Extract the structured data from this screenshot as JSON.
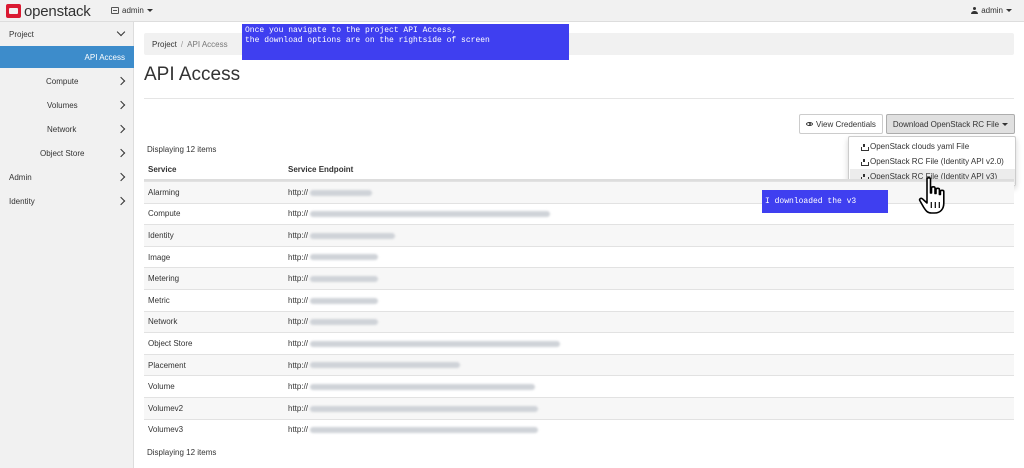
{
  "topbar": {
    "logo_text": "openstack",
    "project": "admin",
    "user": "admin"
  },
  "sidebar": {
    "items": [
      {
        "label": "Project",
        "expanded": true
      },
      {
        "label": "API Access",
        "active": true
      },
      {
        "label": "Compute"
      },
      {
        "label": "Volumes"
      },
      {
        "label": "Network"
      },
      {
        "label": "Object Store"
      },
      {
        "label": "Admin"
      },
      {
        "label": "Identity"
      }
    ]
  },
  "breadcrumb": {
    "root": "Project",
    "separator": "/",
    "current": "API Access"
  },
  "page": {
    "title": "API Access",
    "view_credentials_label": "View Credentials",
    "download_label": "Download OpenStack RC File",
    "displaying_top": "Displaying 12 items",
    "displaying_bottom": "Displaying 12 items"
  },
  "download_menu": {
    "items": [
      {
        "label": "OpenStack clouds yaml File"
      },
      {
        "label": "OpenStack RC File (Identity API v2.0)"
      },
      {
        "label": "OpenStack RC File (Identity API v3)",
        "hovered": true
      }
    ]
  },
  "table": {
    "headers": [
      "Service",
      "Service Endpoint"
    ],
    "rows": [
      {
        "service": "Alarming",
        "endpoint": "http://"
      },
      {
        "service": "Compute",
        "endpoint": "http://"
      },
      {
        "service": "Identity",
        "endpoint": "http://"
      },
      {
        "service": "Image",
        "endpoint": "http://"
      },
      {
        "service": "Metering",
        "endpoint": "http://"
      },
      {
        "service": "Metric",
        "endpoint": "http://"
      },
      {
        "service": "Network",
        "endpoint": "http://"
      },
      {
        "service": "Object Store",
        "endpoint": "http://"
      },
      {
        "service": "Placement",
        "endpoint": "http://"
      },
      {
        "service": "Volume",
        "endpoint": "http://"
      },
      {
        "service": "Volumev2",
        "endpoint": "http://"
      },
      {
        "service": "Volumev3",
        "endpoint": "http://"
      }
    ]
  },
  "annotations": {
    "note_1": "Once you navigate to the project API Access,\nthe download options are on the rightside of screen",
    "note_2": "I downloaded the v3"
  },
  "colors": {
    "active_nav": "#3d8ccb",
    "annotation": "#3f3ff0",
    "brand": "#da1a32"
  }
}
